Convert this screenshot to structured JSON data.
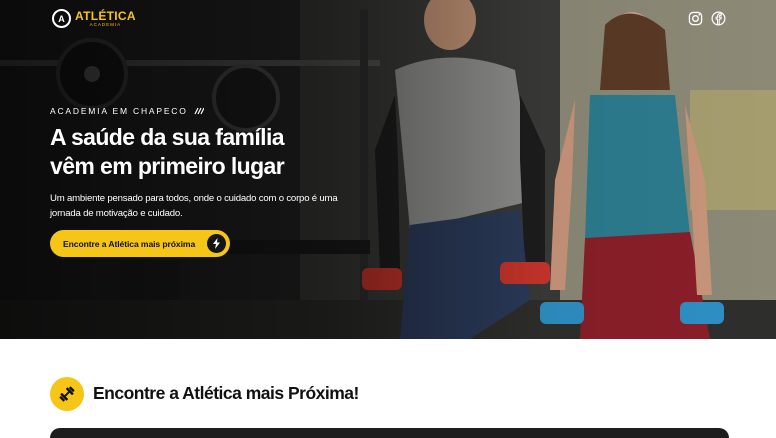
{
  "header": {
    "logo_name": "ATLÉTICA",
    "logo_sub": "ACADEMIA",
    "logo_mark": "A",
    "social": [
      {
        "icon": "instagram-icon"
      },
      {
        "icon": "facebook-icon"
      }
    ]
  },
  "hero": {
    "eyebrow": "ACADEMIA EM CHAPECO",
    "headline_line1": "A saúde da sua família",
    "headline_line2": "vêm em primeiro lugar",
    "subtext": "Um ambiente pensado para todos, onde o cuidado com o corpo é uma jornada de motivação e cuidado.",
    "cta_label": "Encontre a Atlética mais próxima",
    "cta_icon": "lightning-icon"
  },
  "section": {
    "icon": "dumbbell-icon",
    "title": "Encontre a Atlética mais Próxima!"
  },
  "colors": {
    "brand_yellow": "#f5c518",
    "dark": "#1d1d1d",
    "text": "#111111"
  }
}
